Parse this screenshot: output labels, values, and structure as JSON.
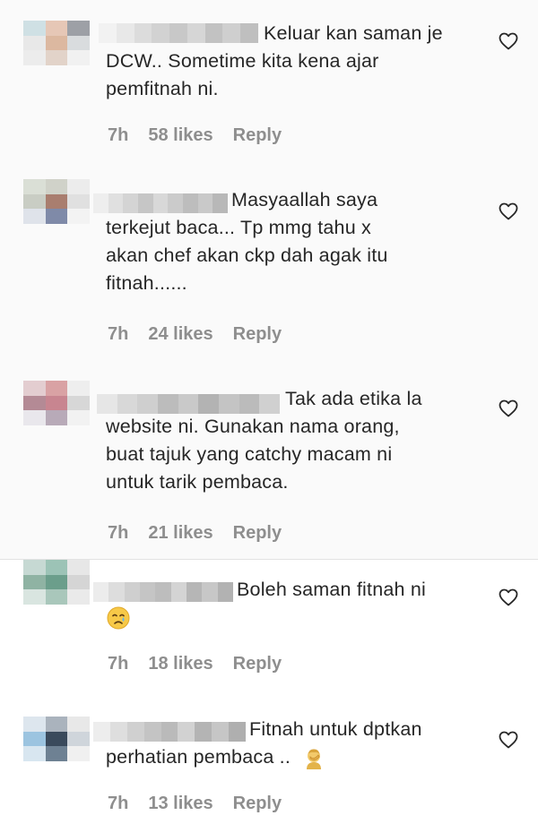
{
  "comments": [
    {
      "text_lines": [
        "Keluar kan saman je",
        "DCW.. Sometime kita kena ajar",
        "pemfitnah ni."
      ],
      "time": "7h",
      "likes": "58 likes",
      "reply": "Reply",
      "avatar_colors": [
        "#cfe0e4",
        "#e6c7b6",
        "#9da0a6",
        "#e8e8e8",
        "#dcb8a0",
        "#d9dcde",
        "#ececec",
        "#e2d3c9",
        "#f1f1f1"
      ],
      "username_colors": [
        "#f2f2f2",
        "#e8e8e8",
        "#dcdcdc",
        "#d2d2d2",
        "#c8c8c8",
        "#d6d6d6",
        "#c2c2c2",
        "#cfcfcf",
        "#bfbfbf"
      ]
    },
    {
      "text_lines": [
        "Masyaallah saya",
        "terkejut baca... Tp mmg tahu x",
        "akan chef akan ckp dah agak itu",
        "fitnah......"
      ],
      "time": "7h",
      "likes": "24 likes",
      "reply": "Reply",
      "avatar_colors": [
        "#dadfd6",
        "#d0d2c9",
        "#ececec",
        "#c9cdc4",
        "#a97e6f",
        "#e0e0e0",
        "#dfe3ea",
        "#7f8aa8",
        "#f3f3f3"
      ],
      "username_colors": [
        "#eeeeee",
        "#e0e0e0",
        "#d4d4d4",
        "#c6c6c6",
        "#d8d8d8",
        "#cbcbcb",
        "#bdbdbd",
        "#c9c9c9",
        "#b8b8b8"
      ]
    },
    {
      "text_lines": [
        "Tak ada etika la",
        "website ni. Gunakan nama orang,",
        "buat tajuk yang catchy macam ni",
        "untuk tarik pembaca."
      ],
      "time": "7h",
      "likes": "21 likes",
      "reply": "Reply",
      "avatar_colors": [
        "#e3cdd0",
        "#d9a2a4",
        "#eeeeee",
        "#b48a95",
        "#c88590",
        "#d7d7d7",
        "#e9e7ec",
        "#b8aab8",
        "#f2f2f2"
      ],
      "username_colors": [
        "#e6e6e6",
        "#d8d8d8",
        "#cfcfcf",
        "#bcbcbc",
        "#c9c9c9",
        "#b3b3b3",
        "#c4c4c4",
        "#bbbbbb",
        "#d0d0d0"
      ]
    },
    {
      "text_lines": [
        "Boleh saman fitnah ni"
      ],
      "emoji": "crying-face-emoji",
      "time": "7h",
      "likes": "18 likes",
      "reply": "Reply",
      "avatar_colors": [
        "#c6d9d3",
        "#9cc3b6",
        "#e7e7e7",
        "#8fb3a3",
        "#6b9e8b",
        "#d5d5d5",
        "#d9e5e0",
        "#a9c7bb",
        "#eaeaea"
      ],
      "username_colors": [
        "#ececec",
        "#dddddd",
        "#cfcfcf",
        "#c5c5c5",
        "#bdbdbd",
        "#d4d4d4",
        "#b6b6b6",
        "#c7c7c7",
        "#b2b2b2"
      ]
    },
    {
      "text_lines": [
        "Fitnah untuk dptkan",
        "perhatian pembaca .."
      ],
      "emoji": "person-facepalming-emoji",
      "time": "7h",
      "likes": "13 likes",
      "reply": "Reply",
      "avatar_colors": [
        "#dde6ee",
        "#aab3bd",
        "#e8e8e8",
        "#9cc4e0",
        "#3a4a5c",
        "#cfd5db",
        "#d8e6f0",
        "#6e8193",
        "#f0f0f0"
      ],
      "username_colors": [
        "#ededed",
        "#dedede",
        "#d0d0d0",
        "#c4c4c4",
        "#bababa",
        "#d2d2d2",
        "#b4b4b4",
        "#c6c6c6",
        "#afafaf"
      ]
    }
  ],
  "icons": {
    "like": "heart-outline-icon"
  },
  "colors": {
    "text": "#262626",
    "meta": "#8e8e8e",
    "background": "#ffffff",
    "panel": "#fafafa",
    "separator": "#e3e3e3"
  }
}
